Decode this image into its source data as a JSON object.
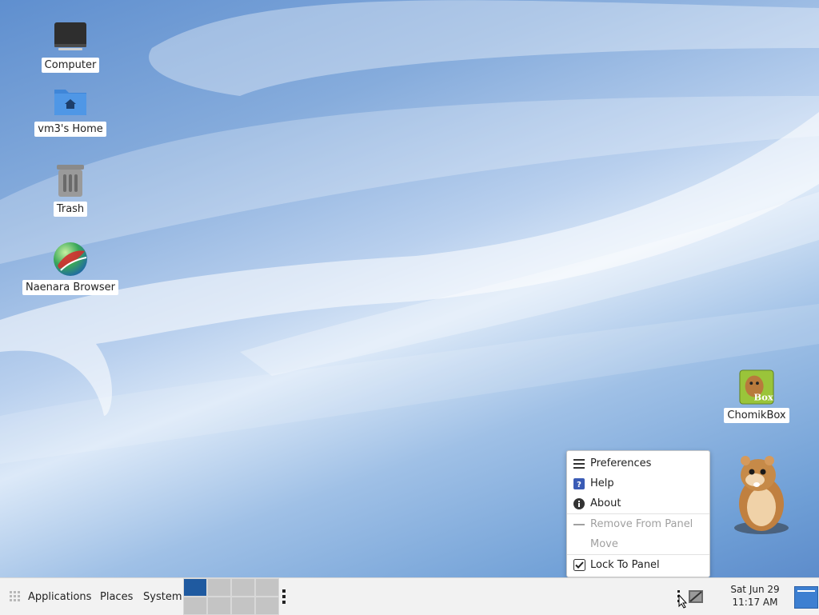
{
  "desktop": {
    "icons": [
      {
        "label": "Computer",
        "icon": "computer-icon"
      },
      {
        "label": "vm3's Home",
        "icon": "home-folder-icon"
      },
      {
        "label": "Trash",
        "icon": "trash-icon"
      },
      {
        "label": "Naenara Browser",
        "icon": "browser-globe-icon"
      },
      {
        "label": "ChomikBox",
        "icon": "chomikbox-icon"
      }
    ]
  },
  "context_menu": {
    "items": [
      {
        "label": "Preferences",
        "icon": "preferences-list-icon",
        "enabled": true
      },
      {
        "label": "Help",
        "icon": "help-icon",
        "enabled": true
      },
      {
        "label": "About",
        "icon": "info-icon",
        "enabled": true
      },
      {
        "label": "Remove From Panel",
        "icon": "remove-dash-icon",
        "enabled": false
      },
      {
        "label": "Move",
        "icon": "",
        "enabled": false
      },
      {
        "label": "Lock To Panel",
        "icon": "checkbox-checked-icon",
        "enabled": true,
        "checked": true
      }
    ]
  },
  "panel": {
    "applications": "Applications",
    "places": "Places",
    "system": "System",
    "workspace_count": 8,
    "active_workspace": 1,
    "clock_date": "Sat Jun 29",
    "clock_time": "11:17 AM"
  },
  "colors": {
    "panel_bg": "#f2f2f2",
    "active_workspace": "#1f5aa0",
    "show_desktop": "#3d7fd1"
  }
}
